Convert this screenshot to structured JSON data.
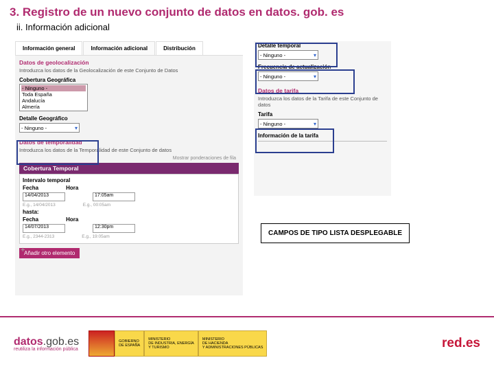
{
  "title": "3. Registro de un nuevo conjunto de datos en datos. gob. es",
  "subtitle": "ii. Información adicional",
  "tabs": [
    "Información general",
    "Información adicional",
    "Distribución"
  ],
  "left": {
    "geo_hdr": "Datos de geolocalización",
    "geo_txt": "Introduzca los datos de la Geolocalización de este Conjunto de Datos",
    "cov_label": "Cobertura Geográfica",
    "cov_opts": [
      "- Ninguno -",
      "Toda España",
      "Andalucía",
      "Almería"
    ],
    "det_label": "Detalle Geográfico",
    "det_val": "- Ninguno -",
    "temp_hdr": "Datos de temporalidad",
    "temp_txt": "Introduzca los datos de la Temporalidad de este Conjunto de datos",
    "override": "Mostrar ponderaciones de fila",
    "cob_temp": "Cobertura Temporal",
    "cob_sub": "Intervalo temporal",
    "fecha": "Fecha",
    "hora": "Hora",
    "d1": "14/04/2013",
    "t1": "17:05am",
    "eg1": "E.g., 14/04/2013",
    "eg2": "E.g., 00:05am",
    "hasta": "hasta:",
    "d2": "14/07/2013",
    "t2": "12:30pm",
    "eg3": "E.g., 2344-2313",
    "eg4": "E.g., 19:05am",
    "add": "Añadir otro elemento"
  },
  "right": {
    "det_label": "Detalle temporal",
    "det_val": "- Ninguno -",
    "freq_label": "Frecuencia de actualización",
    "freq_val": "- Ninguno -",
    "tarifa_hdr": "Datos de tarifa",
    "tarifa_txt": "Introduzca los datos de la Tarifa de este Conjunto de datos",
    "tarifa_label": "Tarifa",
    "tarifa_val": "- Ninguno -",
    "info_label": "Información de la tarifa"
  },
  "callout": "CAMPOS DE TIPO LISTA DESPLEGABLE",
  "footer": {
    "datos1a": "datos",
    "datos1b": ".gob.es",
    "datos2": "reutiliza la información pública",
    "gov1": "GOBIERNO\nDE ESPAÑA",
    "gov2": "MINISTERIO\nDE INDUSTRIA, ENERGÍA\nY TURISMO",
    "gov3": "MINISTERIO\nDE HACIENDA\nY ADMINISTRACIONES PÚBLICAS",
    "red": "red.",
    "redes": "es"
  }
}
